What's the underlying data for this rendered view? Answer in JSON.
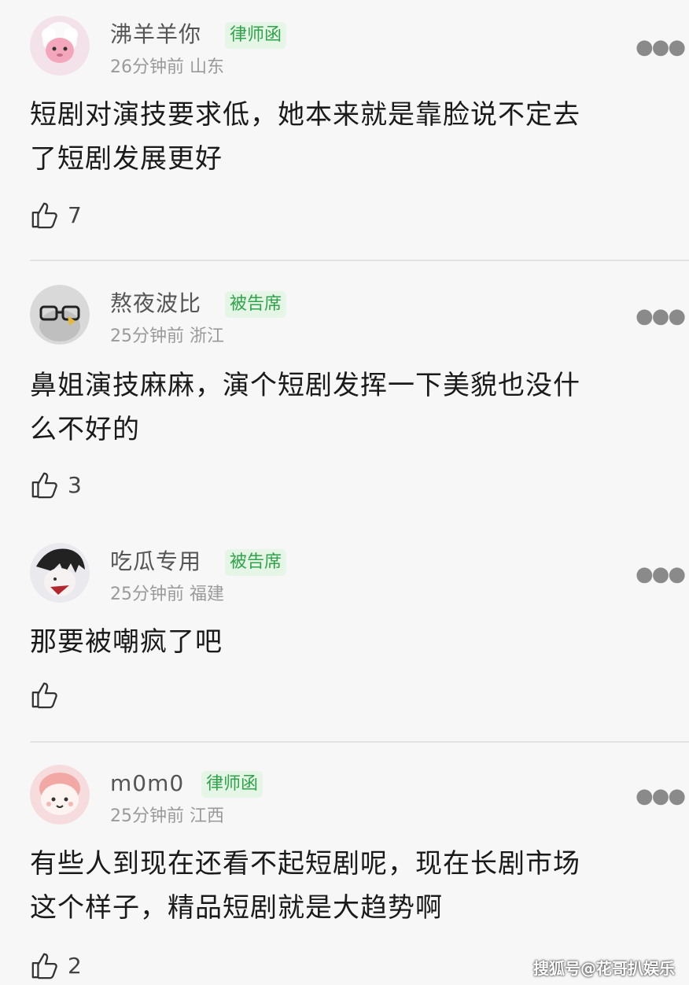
{
  "comments": [
    {
      "name": "沸羊羊你",
      "badge": "律师函",
      "time": "26分钟前",
      "location": "山东",
      "text_lines": [
        "短剧对演技要求低，她本来就是靠脸说不定去",
        "了短剧发展更好"
      ],
      "likes": "7"
    },
    {
      "name": "熬夜波比",
      "badge": "被告席",
      "time": "25分钟前",
      "location": "浙江",
      "text_lines": [
        "鼻姐演技麻麻，演个短剧发挥一下美貌也没什",
        "么不好的"
      ],
      "likes": "3"
    },
    {
      "name": "吃瓜专用",
      "badge": "被告席",
      "time": "25分钟前",
      "location": "福建",
      "text_lines": [
        "那要被嘲疯了吧"
      ],
      "likes": ""
    },
    {
      "name": "m0m0",
      "badge": "律师函",
      "time": "25分钟前",
      "location": "江西",
      "text_lines": [
        "有些人到现在还看不起短剧呢，现在长剧市场",
        "这个样子，精品短剧就是大趋势啊"
      ],
      "likes": "2"
    }
  ],
  "icons": {
    "like": "thumbs-up-icon",
    "more": "more-dots-icon"
  },
  "colors": {
    "badge_text": "#2fa34a",
    "badge_bg": "#e6f6e6",
    "meta": "#9a9a9a"
  },
  "watermark": "搜狐号@花哥扒娱乐"
}
